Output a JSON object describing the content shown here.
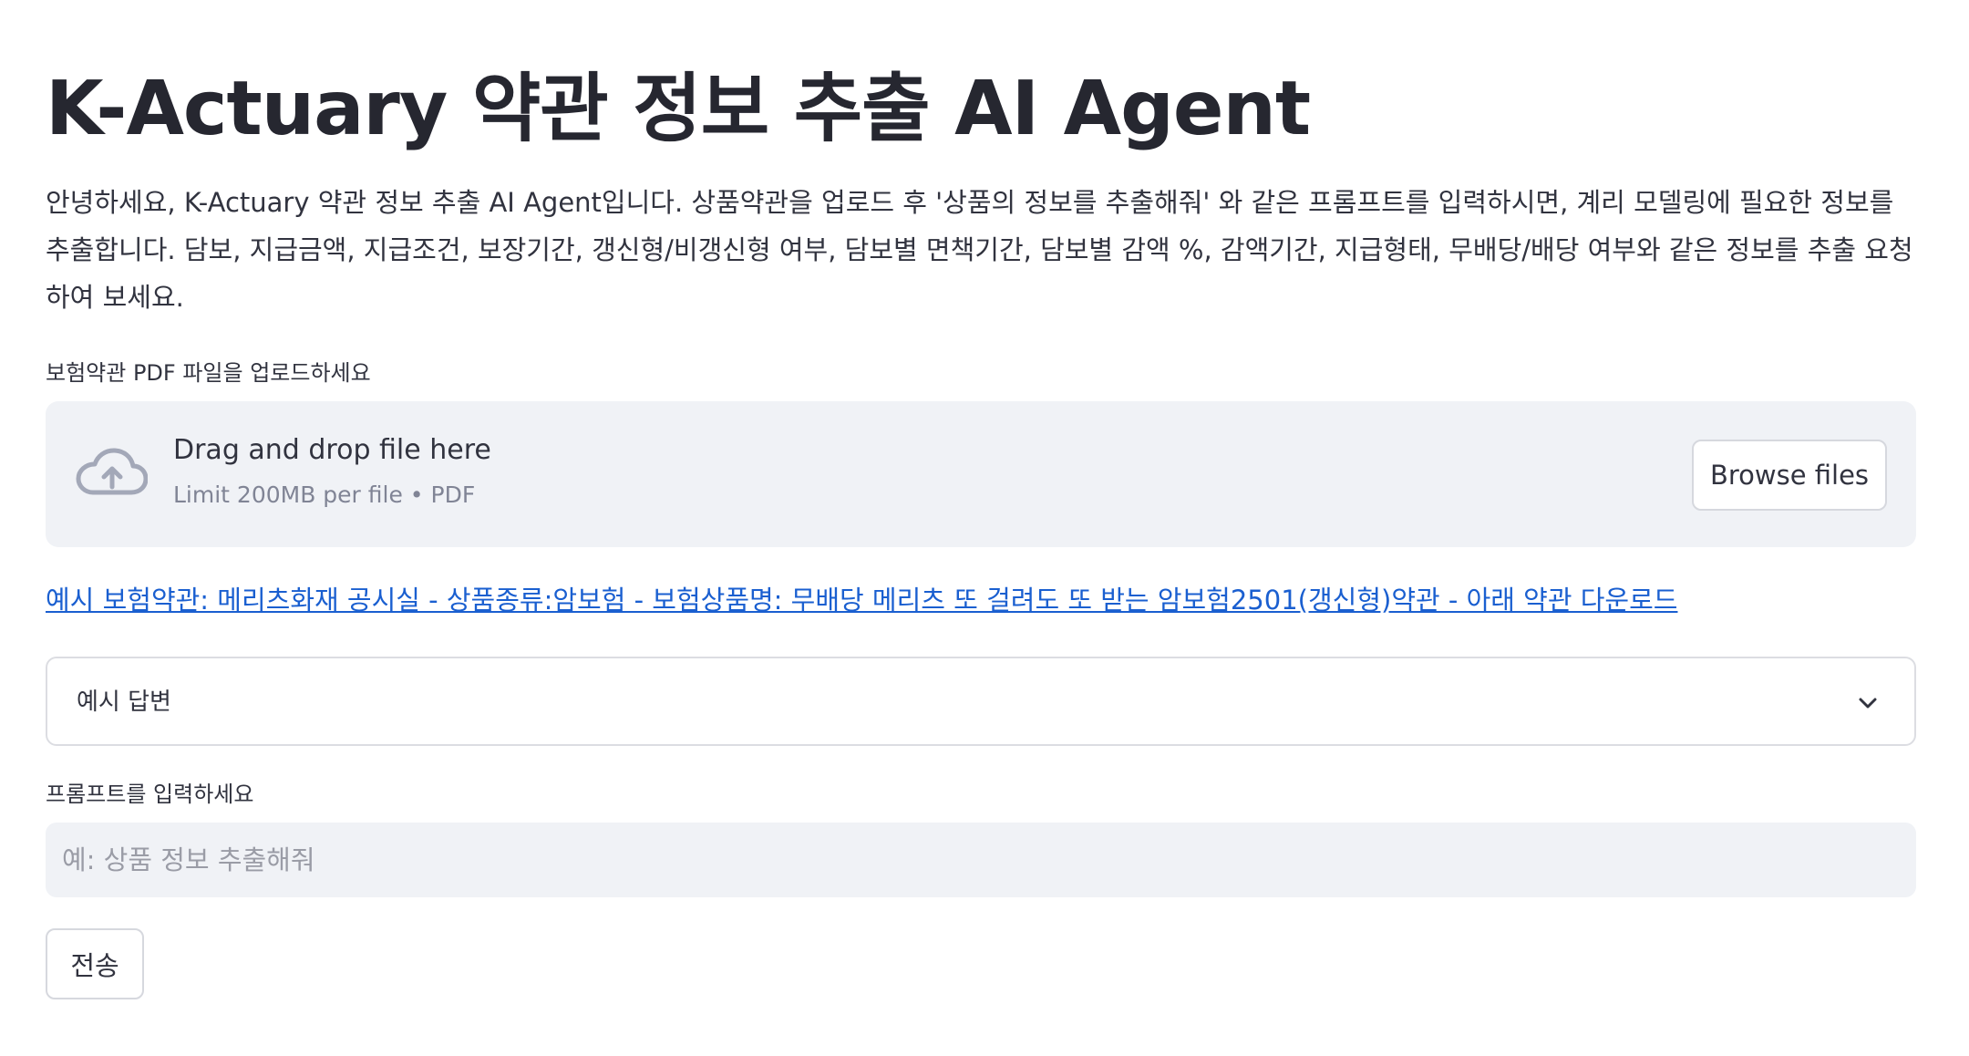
{
  "header": {
    "title": "K-Actuary 약관 정보 추출 AI Agent"
  },
  "intro": {
    "text": "안녕하세요, K-Actuary 약관 정보 추출 AI Agent입니다. 상품약관을 업로드 후 '상품의 정보를 추출해줘' 와 같은 프롬프트를 입력하시면, 계리 모델링에 필요한 정보를 추출합니다. 담보, 지급금액, 지급조건, 보장기간, 갱신형/비갱신형 여부, 담보별 면책기간, 담보별 감액 %, 감액기간, 지급형태, 무배당/배당 여부와 같은 정보를 추출 요청하여 보세요."
  },
  "uploader": {
    "label": "보험약관 PDF 파일을 업로드하세요",
    "drop_text": "Drag and drop file here",
    "limit_text": "Limit 200MB per file • PDF",
    "browse_label": "Browse files",
    "icon": "cloud-upload-icon"
  },
  "example_link": {
    "text": "예시 보험약관: 메리츠화재 공시실 - 상품종류:암보험 - 보험상품명: 무배당 메리츠 또 걸려도 또 받는 암보험2501(갱신형)약관 - 아래 약관 다운로드"
  },
  "expander": {
    "label": "예시 답변",
    "icon": "chevron-down-icon"
  },
  "prompt": {
    "label": "프롬프트를 입력하세요",
    "value": "",
    "placeholder": "예: 상품 정보 추출해줘"
  },
  "submit": {
    "label": "전송"
  },
  "colors": {
    "link": "#1a5fd0",
    "input_bg": "#f0f2f6",
    "text": "#31333f",
    "muted": "#808495"
  }
}
